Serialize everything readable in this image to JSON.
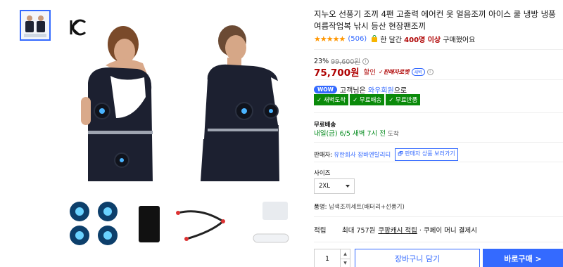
{
  "product": {
    "title": "지누오 선풍기 조끼 4팬 고출력 에어컨 옷 얼음조끼 아이스 쿨 냉방 냉풍 여름작업복 낚시 등산 현장팬조끼",
    "rating_stars": "★★★★★",
    "rating_value": 4.5,
    "review_count": "(506)",
    "buyers_text_prefix": "한 달간",
    "buyers_count": "400명 이상",
    "buyers_text_suffix": "구매했어요"
  },
  "price": {
    "discount_rate": "23%",
    "original_price": "99,600원",
    "sale_price": "75,700원",
    "sale_label": "할인",
    "rocket_label": "판매자로켓",
    "rocket_badge": "새벽"
  },
  "wow": {
    "badge": "WOW",
    "text_prefix": "고객님은",
    "link": "와우회원",
    "text_suffix": "으로",
    "tags": [
      "✓ 새벽도착",
      "✓ 무료배송",
      "✓ 무료반품"
    ]
  },
  "shipping": {
    "label": "무료배송",
    "date": "내일(금) 6/5 새벽 7시 전",
    "date_suffix": "도착"
  },
  "seller": {
    "label": "판매자:",
    "name": "유한회사 잠바엔탈리티",
    "button": "판매자 상품 보러가기"
  },
  "options": {
    "size_label": "사이즈",
    "size_value": "2XL",
    "item_label": "품명:",
    "item_value": "남색조끼세트(배터리+선풍기)"
  },
  "points": {
    "label": "적립",
    "text": "최대 757원",
    "link": "쿠팡캐시 적립",
    "suffix": "· 쿠페이 머니 결제시"
  },
  "purchase": {
    "quantity": "1",
    "cart_button": "장바구니 담기",
    "buy_button": "바로구매 >"
  },
  "colors": {
    "accent_blue": "#346aff",
    "price_red": "#ae0000",
    "badge_green": "#0a8a0a"
  }
}
